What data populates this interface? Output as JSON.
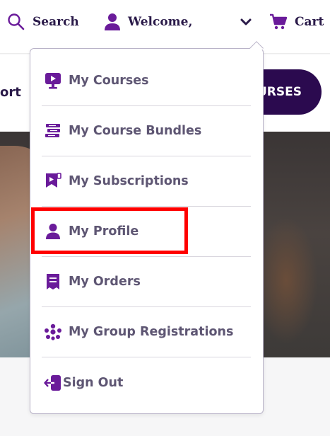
{
  "topbar": {
    "search_label": "Search",
    "welcome_label": "Welcome,",
    "cart_label": "Cart",
    "icons": [
      "search-icon",
      "user-icon",
      "chevron-down-icon",
      "cart-icon"
    ]
  },
  "subbar": {
    "partial_nav_text": "ort",
    "courses_button_label": "URSES"
  },
  "dropdown": {
    "items": [
      {
        "label": "My Courses",
        "icon": "video-course-icon"
      },
      {
        "label": "My Course Bundles",
        "icon": "bundle-icon"
      },
      {
        "label": "My Subscriptions",
        "icon": "subscription-icon"
      },
      {
        "label": "My Profile",
        "icon": "user-icon"
      },
      {
        "label": "My Orders",
        "icon": "receipt-icon"
      },
      {
        "label": "My Group Registrations",
        "icon": "group-icon"
      },
      {
        "label": "Sign Out",
        "icon": "sign-out-icon"
      }
    ]
  },
  "colors": {
    "accent": "#6a1b9a",
    "dark_purple": "#2b0a4f",
    "menu_text": "#5e5673",
    "highlight": "#ff0000"
  }
}
